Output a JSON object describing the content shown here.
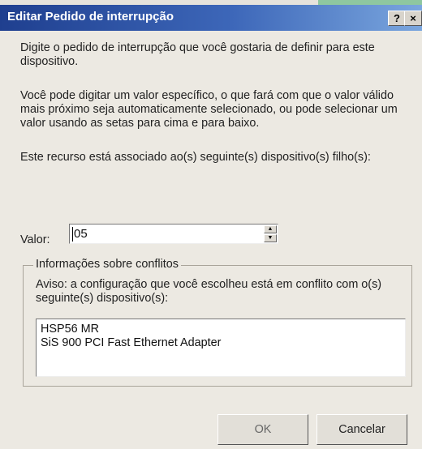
{
  "window": {
    "title": "Editar Pedido de interrupção",
    "help_button": "?",
    "close_button": "×"
  },
  "instructions": {
    "paragraph1": "Digite o pedido de interrupção que você gostaria de definir para este dispositivo.",
    "paragraph2": "Você pode digitar um valor específico, o que fará com que o valor válido mais próximo seja automaticamente selecionado, ou pode selecionar um valor usando as setas para cima e para baixo.",
    "paragraph3": "Este recurso está associado ao(s) seguinte(s) dispositivo(s) filho(s):"
  },
  "value_field": {
    "label": "Valor:",
    "value": "05"
  },
  "conflicts": {
    "legend": "Informações sobre conflitos",
    "warning": "Aviso: a configuração que você escolheu está em conflito com o(s) seguinte(s) dispositivo(s):",
    "devices": [
      "HSP56 MR",
      "SiS 900 PCI Fast Ethernet Adapter"
    ]
  },
  "buttons": {
    "ok": "OK",
    "cancel": "Cancelar"
  }
}
